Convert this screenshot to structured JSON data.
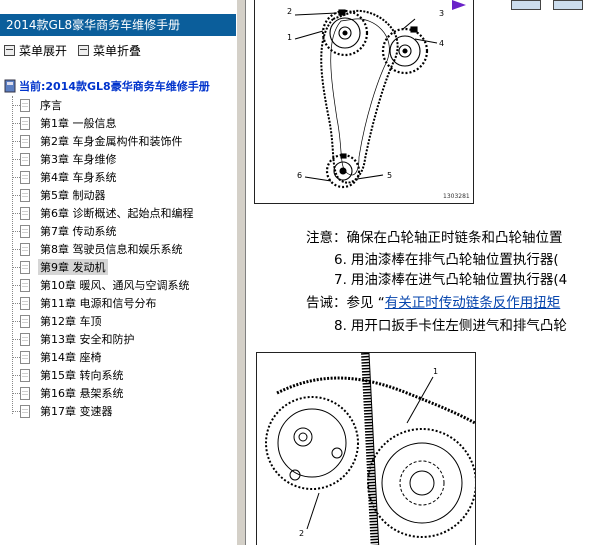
{
  "nav": {
    "title": "2014款GL8豪华商务车维修手册",
    "toolbar": {
      "expand": "菜单展开",
      "collapse": "菜单折叠"
    },
    "root": "当前:2014款GL8豪华商务车维修手册",
    "items": [
      {
        "label": "序言"
      },
      {
        "label": "第1章 一般信息"
      },
      {
        "label": "第2章 车身金属构件和装饰件"
      },
      {
        "label": "第3章 车身维修"
      },
      {
        "label": "第4章 车身系统"
      },
      {
        "label": "第5章 制动器"
      },
      {
        "label": "第6章 诊断概述、起始点和编程"
      },
      {
        "label": "第7章 传动系统"
      },
      {
        "label": "第8章 驾驶员信息和娱乐系统"
      },
      {
        "label": "第9章 发动机",
        "selected": true
      },
      {
        "label": "第10章 暖风、通风与空调系统"
      },
      {
        "label": "第11章 电源和信号分布"
      },
      {
        "label": "第12章 车顶"
      },
      {
        "label": "第13章 安全和防护"
      },
      {
        "label": "第14章 座椅"
      },
      {
        "label": "第15章 转向系统"
      },
      {
        "label": "第16章 悬架系统"
      },
      {
        "label": "第17章 变速器"
      }
    ]
  },
  "doc": {
    "figure1": {
      "code": "1303281",
      "callouts": [
        "2",
        "3",
        "1",
        "4",
        "6",
        "5"
      ]
    },
    "notice": "注意：确保在凸轮轴正时链条和凸轮轴位置",
    "step6": {
      "num": "6.",
      "text": "用油漆棒在排气凸轮轴位置执行器("
    },
    "step7": {
      "num": "7.",
      "text": "用油漆棒在进气凸轮轴位置执行器(4"
    },
    "warning": {
      "label": "告诫：参见 “",
      "link": "有关正时传动链条反作用扭矩"
    },
    "step8": {
      "num": "8.",
      "text": "用开口扳手卡住左侧进气和排气凸轮"
    },
    "figure2": {
      "callouts": [
        "1",
        "2"
      ]
    }
  },
  "colors": {
    "title_bar": "#0b5e9b",
    "root_text": "#0033cc",
    "link": "#0645ad"
  }
}
